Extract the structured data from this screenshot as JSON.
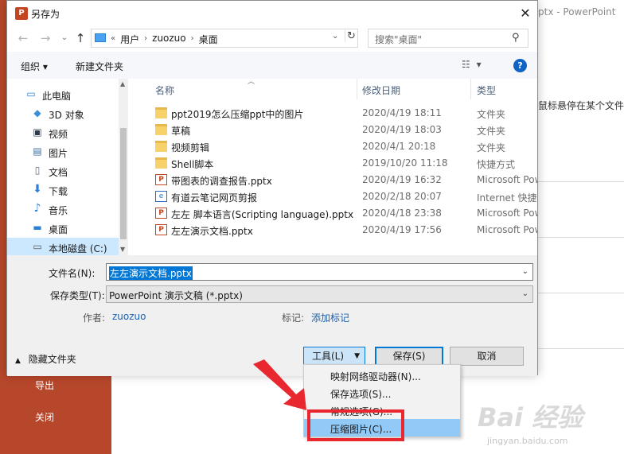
{
  "background": {
    "window_title": "ptx - PowerPoint",
    "hint_text": "鼠标悬停在某个文件",
    "sidebar_items": [
      "导出",
      "关闭"
    ]
  },
  "dialog": {
    "title": "另存为",
    "close_glyph": "✕",
    "breadcrumb": [
      "用户",
      "zuozuo",
      "桌面"
    ],
    "breadcrumb_prefix": "«",
    "search_placeholder": "搜索\"桌面\"",
    "toolbar": {
      "organize": "组织 ▾",
      "new_folder": "新建文件夹"
    },
    "nav_pane": [
      {
        "label": "此电脑",
        "icon": "computer-icon",
        "selected": false
      },
      {
        "label": "3D 对象",
        "icon": "cube-icon",
        "selected": false
      },
      {
        "label": "视频",
        "icon": "video-icon",
        "selected": false
      },
      {
        "label": "图片",
        "icon": "picture-icon",
        "selected": false
      },
      {
        "label": "文档",
        "icon": "document-icon",
        "selected": false
      },
      {
        "label": "下载",
        "icon": "download-icon",
        "selected": false
      },
      {
        "label": "音乐",
        "icon": "music-icon",
        "selected": false
      },
      {
        "label": "桌面",
        "icon": "desktop-icon",
        "selected": false
      },
      {
        "label": "本地磁盘 (C:)",
        "icon": "drive-icon",
        "selected": true
      }
    ],
    "columns": {
      "name": "名称",
      "date": "修改日期",
      "type": "类型"
    },
    "files": [
      {
        "name": "ppt2019怎么压缩ppt中的图片",
        "date": "2020/4/19 18:11",
        "type": "文件夹",
        "icon": "folder"
      },
      {
        "name": "草稿",
        "date": "2020/4/19 18:03",
        "type": "文件夹",
        "icon": "folder"
      },
      {
        "name": "视频剪辑",
        "date": "2020/4/1 20:18",
        "type": "文件夹",
        "icon": "folder"
      },
      {
        "name": "Shell脚本",
        "date": "2019/10/20 11:18",
        "type": "快捷方式",
        "icon": "folder"
      },
      {
        "name": "带图表的调查报告.pptx",
        "date": "2020/4/19 16:32",
        "type": "Microsoft Pow",
        "icon": "ppt"
      },
      {
        "name": "有道云笔记网页剪报",
        "date": "2020/2/18 20:07",
        "type": "Internet 快捷方",
        "icon": "web"
      },
      {
        "name": "左左 脚本语言(Scripting language).pptx",
        "date": "2020/4/18 23:38",
        "type": "Microsoft Pow",
        "icon": "ppt"
      },
      {
        "name": "左左演示文档.pptx",
        "date": "2020/4/19 17:56",
        "type": "Microsoft Pow",
        "icon": "ppt"
      }
    ],
    "form": {
      "filename_label": "文件名(N):",
      "filename_value": "左左演示文档.pptx",
      "filetype_label": "保存类型(T):",
      "filetype_value": "PowerPoint 演示文稿 (*.pptx)",
      "author_label": "作者:",
      "author_value": "zuozuo",
      "tags_label": "标记:",
      "tags_value": "添加标记",
      "hide_folders": "隐藏文件夹"
    },
    "buttons": {
      "tools": "工具(L)",
      "save": "保存(S)",
      "cancel": "取消"
    }
  },
  "tools_menu": [
    {
      "label": "映射网络驱动器(N)...",
      "highlighted": false
    },
    {
      "label": "保存选项(S)...",
      "highlighted": false
    },
    {
      "label": "常规选项(G)...",
      "highlighted": false
    },
    {
      "label": "压缩图片(C)...",
      "highlighted": true
    }
  ],
  "watermark": {
    "main": "Bai 经验",
    "sub": "jingyan.baidu.com"
  },
  "colors": {
    "accent": "#0078d7",
    "highlight": "#91c9f7",
    "annotation": "#e8272f",
    "backstage": "#b7472a"
  }
}
